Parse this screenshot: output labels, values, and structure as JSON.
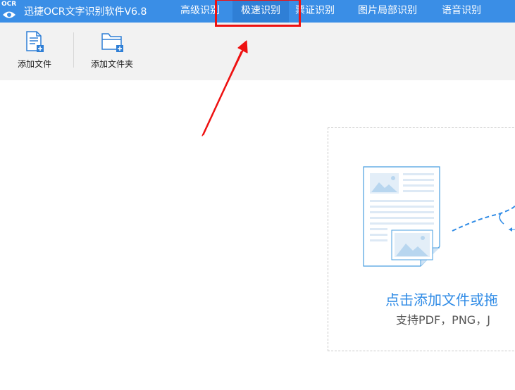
{
  "app": {
    "logo_text": "OCR",
    "title": "迅捷OCR文字识别软件V6.8"
  },
  "tabs": [
    {
      "label": "高级识别"
    },
    {
      "label": "极速识别"
    },
    {
      "label": "票证识别"
    },
    {
      "label": "图片局部识别"
    },
    {
      "label": "语音识别"
    }
  ],
  "toolbar": {
    "add_file_label": "添加文件",
    "add_folder_label": "添加文件夹"
  },
  "dropzone": {
    "main_text": "点击添加文件或拖",
    "sub_text": "支持PDF，PNG，J"
  },
  "colors": {
    "titlebar": "#3a8ee6",
    "accent": "#2f8be6",
    "annotation": "#ee1111"
  },
  "icons": {
    "logo": "ocr-eye-icon",
    "add_file": "add-file-icon",
    "add_folder": "add-folder-icon",
    "document_illustration": "document-illustration-icon"
  }
}
